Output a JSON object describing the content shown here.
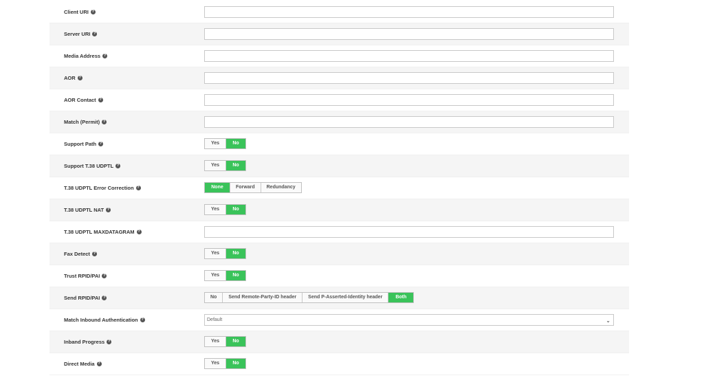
{
  "help_glyph": "?",
  "active_color": "#3ac35a",
  "rows": {
    "client_uri": {
      "label": "Client URI",
      "value": ""
    },
    "server_uri": {
      "label": "Server URI",
      "value": ""
    },
    "media_address": {
      "label": "Media Address",
      "value": ""
    },
    "aor": {
      "label": "AOR",
      "value": ""
    },
    "aor_contact": {
      "label": "AOR Contact",
      "value": ""
    },
    "match_permit": {
      "label": "Match (Permit)",
      "value": ""
    },
    "support_path": {
      "label": "Support Path",
      "options": [
        "Yes",
        "No"
      ],
      "selected": "No"
    },
    "support_t38": {
      "label": "Support T.38 UDPTL",
      "options": [
        "Yes",
        "No"
      ],
      "selected": "No"
    },
    "t38_error": {
      "label": "T.38 UDPTL Error Correction",
      "options": [
        "None",
        "Forward",
        "Redundancy"
      ],
      "selected": "None"
    },
    "t38_nat": {
      "label": "T.38 UDPTL NAT",
      "options": [
        "Yes",
        "No"
      ],
      "selected": "No"
    },
    "t38_maxdatagram": {
      "label": "T.38 UDPTL MAXDATAGRAM",
      "value": ""
    },
    "fax_detect": {
      "label": "Fax Detect",
      "options": [
        "Yes",
        "No"
      ],
      "selected": "No"
    },
    "trust_rpid": {
      "label": "Trust RPID/PAI",
      "options": [
        "Yes",
        "No"
      ],
      "selected": "No"
    },
    "send_rpid": {
      "label": "Send RPID/PAI",
      "options": [
        "No",
        "Send Remote-Party-ID header",
        "Send P-Asserted-Identity header",
        "Both"
      ],
      "selected": "Both"
    },
    "match_inbound_auth": {
      "label": "Match Inbound Authentication",
      "selected": "Default"
    },
    "inband_progress": {
      "label": "Inband Progress",
      "options": [
        "Yes",
        "No"
      ],
      "selected": "No"
    },
    "direct_media": {
      "label": "Direct Media",
      "options": [
        "Yes",
        "No"
      ],
      "selected": "No"
    }
  }
}
